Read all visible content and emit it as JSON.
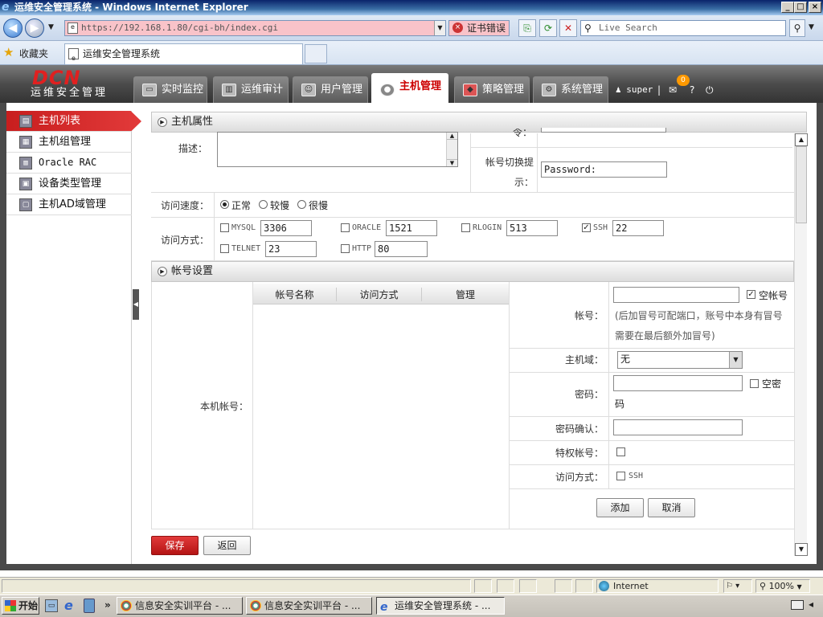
{
  "window": {
    "title": "运维安全管理系统 - Windows Internet Explorer",
    "minimize": "_",
    "maximize": "□",
    "close": "×"
  },
  "browser": {
    "address": "https://192.168.1.80/cgi-bh/index.cgi",
    "cert_error": "证书错误",
    "search_placeholder": "Live Search",
    "favorites_label": "收藏夹",
    "tab_title": "运维安全管理系统"
  },
  "app": {
    "logo_text": "DCN",
    "logo_sub": "运维安全管理",
    "nav": [
      {
        "label": "实时监控",
        "active": false
      },
      {
        "label": "运维审计",
        "active": false
      },
      {
        "label": "用户管理",
        "active": false
      },
      {
        "label": "主机管理",
        "active": true
      },
      {
        "label": "策略管理",
        "active": false
      },
      {
        "label": "系统管理",
        "active": false
      }
    ],
    "username": "super",
    "separator": "|",
    "notif_count": "0",
    "help": "?",
    "logout": "⏻"
  },
  "sidebar": {
    "items": [
      {
        "label": "主机列表",
        "active": true
      },
      {
        "label": "主机组管理",
        "active": false
      },
      {
        "label": "Oracle RAC",
        "active": false
      },
      {
        "label": "设备类型管理",
        "active": false
      },
      {
        "label": "主机AD域管理",
        "active": false
      }
    ]
  },
  "host_props": {
    "section_title": "主机属性",
    "desc_label": "描述：",
    "desc_value": "",
    "clipped_label": "令：",
    "switch_hint_label": "帐号切换提示：",
    "switch_hint_label_a": "帐号切换提",
    "switch_hint_label_b": "示：",
    "switch_hint_value": "Password:",
    "speed_label": "访问速度：",
    "speed_options": [
      {
        "label": "正常",
        "selected": true
      },
      {
        "label": "较慢",
        "selected": false
      },
      {
        "label": "很慢",
        "selected": false
      }
    ],
    "access_label": "访问方式：",
    "protocols": [
      {
        "name": "MYSQL",
        "port": "3306",
        "checked": false
      },
      {
        "name": "ORACLE",
        "port": "1521",
        "checked": false
      },
      {
        "name": "RLOGIN",
        "port": "513",
        "checked": false
      },
      {
        "name": "SSH",
        "port": "22",
        "checked": true
      },
      {
        "name": "TELNET",
        "port": "23",
        "checked": false
      },
      {
        "name": "HTTP",
        "port": "80",
        "checked": false
      }
    ]
  },
  "account": {
    "section_title": "帐号设置",
    "local_account_label": "本机帐号：",
    "table_headers": [
      "帐号名称",
      "访问方式",
      "管理"
    ],
    "rows": [],
    "account_label": "帐号：",
    "account_value": "",
    "empty_account_label": "空帐号",
    "empty_account_checked": true,
    "account_hint": "(后加冒号可配端口，账号中本身有冒号需要在最后额外加冒号)",
    "account_hint_a": "(后加冒号可配端口，账号中本身有冒号",
    "account_hint_b": "需要在最后额外加冒号)",
    "domain_label": "主机域：",
    "domain_value": "无",
    "password_label": "密码：",
    "password_value": "",
    "empty_pwd_label": "空密码",
    "empty_pwd_a": "空密",
    "empty_pwd_b": "码",
    "confirm_label": "密码确认：",
    "confirm_value": "",
    "priv_label": "特权帐号：",
    "method_label": "访问方式：",
    "method_option": "SSH",
    "add_button": "添加",
    "cancel_button": "取消"
  },
  "footer": {
    "save_button": "保存",
    "back_button": "返回"
  },
  "statusbar": {
    "zone": "Internet",
    "zoom": "100%"
  },
  "taskbar": {
    "start": "开始",
    "more": "»",
    "tasks": [
      {
        "label": "信息安全实训平台 - ...",
        "active": false
      },
      {
        "label": "信息安全实训平台 - ...",
        "active": false
      },
      {
        "label": "运维安全管理系统 - ...",
        "active": true
      }
    ]
  }
}
